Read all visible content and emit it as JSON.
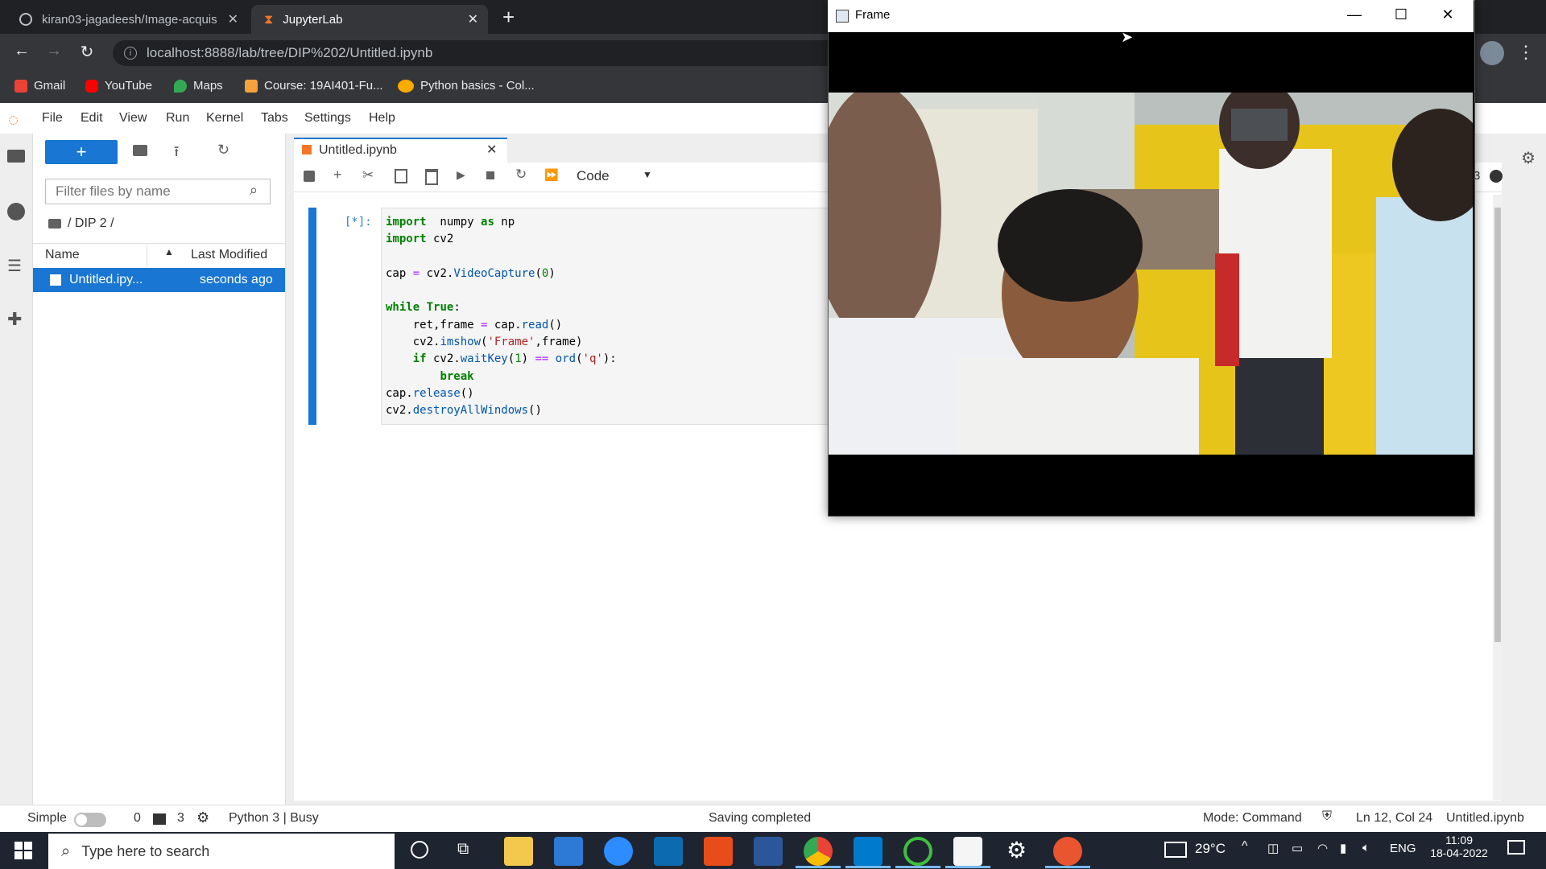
{
  "browser": {
    "tabs": [
      {
        "title": "kiran03-jagadeesh/Image-acquis",
        "active": false
      },
      {
        "title": "JupyterLab",
        "active": true
      }
    ],
    "url": "localhost:8888/lab/tree/DIP%202/Untitled.ipynb",
    "bookmarks": [
      "Gmail",
      "YouTube",
      "Maps",
      "Course: 19AI401-Fu...",
      "Python basics - Col..."
    ]
  },
  "jupyter": {
    "menu": [
      "File",
      "Edit",
      "View",
      "Run",
      "Kernel",
      "Tabs",
      "Settings",
      "Help"
    ],
    "filter_placeholder": "Filter files by name",
    "breadcrumb": "/ DIP 2 /",
    "columns": {
      "name": "Name",
      "modified": "Last Modified"
    },
    "files": [
      {
        "name": "Untitled.ipy...",
        "modified": "seconds ago"
      }
    ],
    "notebook_tab": "Untitled.ipynb",
    "cell_type": "Code",
    "prompt": "[*]:",
    "kernel_indicator_num": "3"
  },
  "code_lines": [
    [
      [
        "kw",
        "import"
      ],
      [
        "",
        "  numpy "
      ],
      [
        "kw",
        "as"
      ],
      [
        "",
        " np"
      ]
    ],
    [
      [
        "kw",
        "import"
      ],
      [
        "",
        " cv2"
      ]
    ],
    [
      [
        "",
        ""
      ]
    ],
    [
      [
        "",
        "cap "
      ],
      [
        "op",
        "="
      ],
      [
        "",
        " cv2."
      ],
      [
        "fn",
        "VideoCapture"
      ],
      [
        "",
        "("
      ],
      [
        "num",
        "0"
      ],
      [
        "",
        ")"
      ]
    ],
    [
      [
        "",
        ""
      ]
    ],
    [
      [
        "kw",
        "while"
      ],
      [
        "",
        " "
      ],
      [
        "kw",
        "True"
      ],
      [
        "",
        ":"
      ]
    ],
    [
      [
        "",
        "    ret,frame "
      ],
      [
        "op",
        "="
      ],
      [
        "",
        " cap."
      ],
      [
        "fn",
        "read"
      ],
      [
        "",
        "()"
      ]
    ],
    [
      [
        "",
        "    cv2."
      ],
      [
        "fn",
        "imshow"
      ],
      [
        "",
        "("
      ],
      [
        "str",
        "'Frame'"
      ],
      [
        "",
        ",frame)"
      ]
    ],
    [
      [
        "",
        "    "
      ],
      [
        "kw",
        "if"
      ],
      [
        "",
        " cv2."
      ],
      [
        "fn",
        "waitKey"
      ],
      [
        "",
        "("
      ],
      [
        "num",
        "1"
      ],
      [
        "",
        ") "
      ],
      [
        "op",
        "=="
      ],
      [
        "",
        " "
      ],
      [
        "fn",
        "ord"
      ],
      [
        "",
        "("
      ],
      [
        "str",
        "'q'"
      ],
      [
        "",
        "):"
      ]
    ],
    [
      [
        "",
        "        "
      ],
      [
        "kw",
        "break"
      ]
    ],
    [
      [
        "",
        "cap."
      ],
      [
        "fn",
        "release"
      ],
      [
        "",
        "()"
      ]
    ],
    [
      [
        "",
        "cv2."
      ],
      [
        "fn",
        "destroyAllWindows"
      ],
      [
        "",
        "()"
      ]
    ]
  ],
  "status": {
    "mode_label": "Simple",
    "count_a": "0",
    "count_b": "3",
    "kernel": "Python 3 | Busy",
    "message": "Saving completed",
    "mode": "Mode: Command",
    "position": "Ln 12, Col 24",
    "filename": "Untitled.ipynb"
  },
  "frame_window": {
    "title": "Frame"
  },
  "taskbar": {
    "search_placeholder": "Type here to search",
    "temperature": "29°C",
    "language": "ENG",
    "time": "11:09",
    "date": "18-04-2022"
  }
}
